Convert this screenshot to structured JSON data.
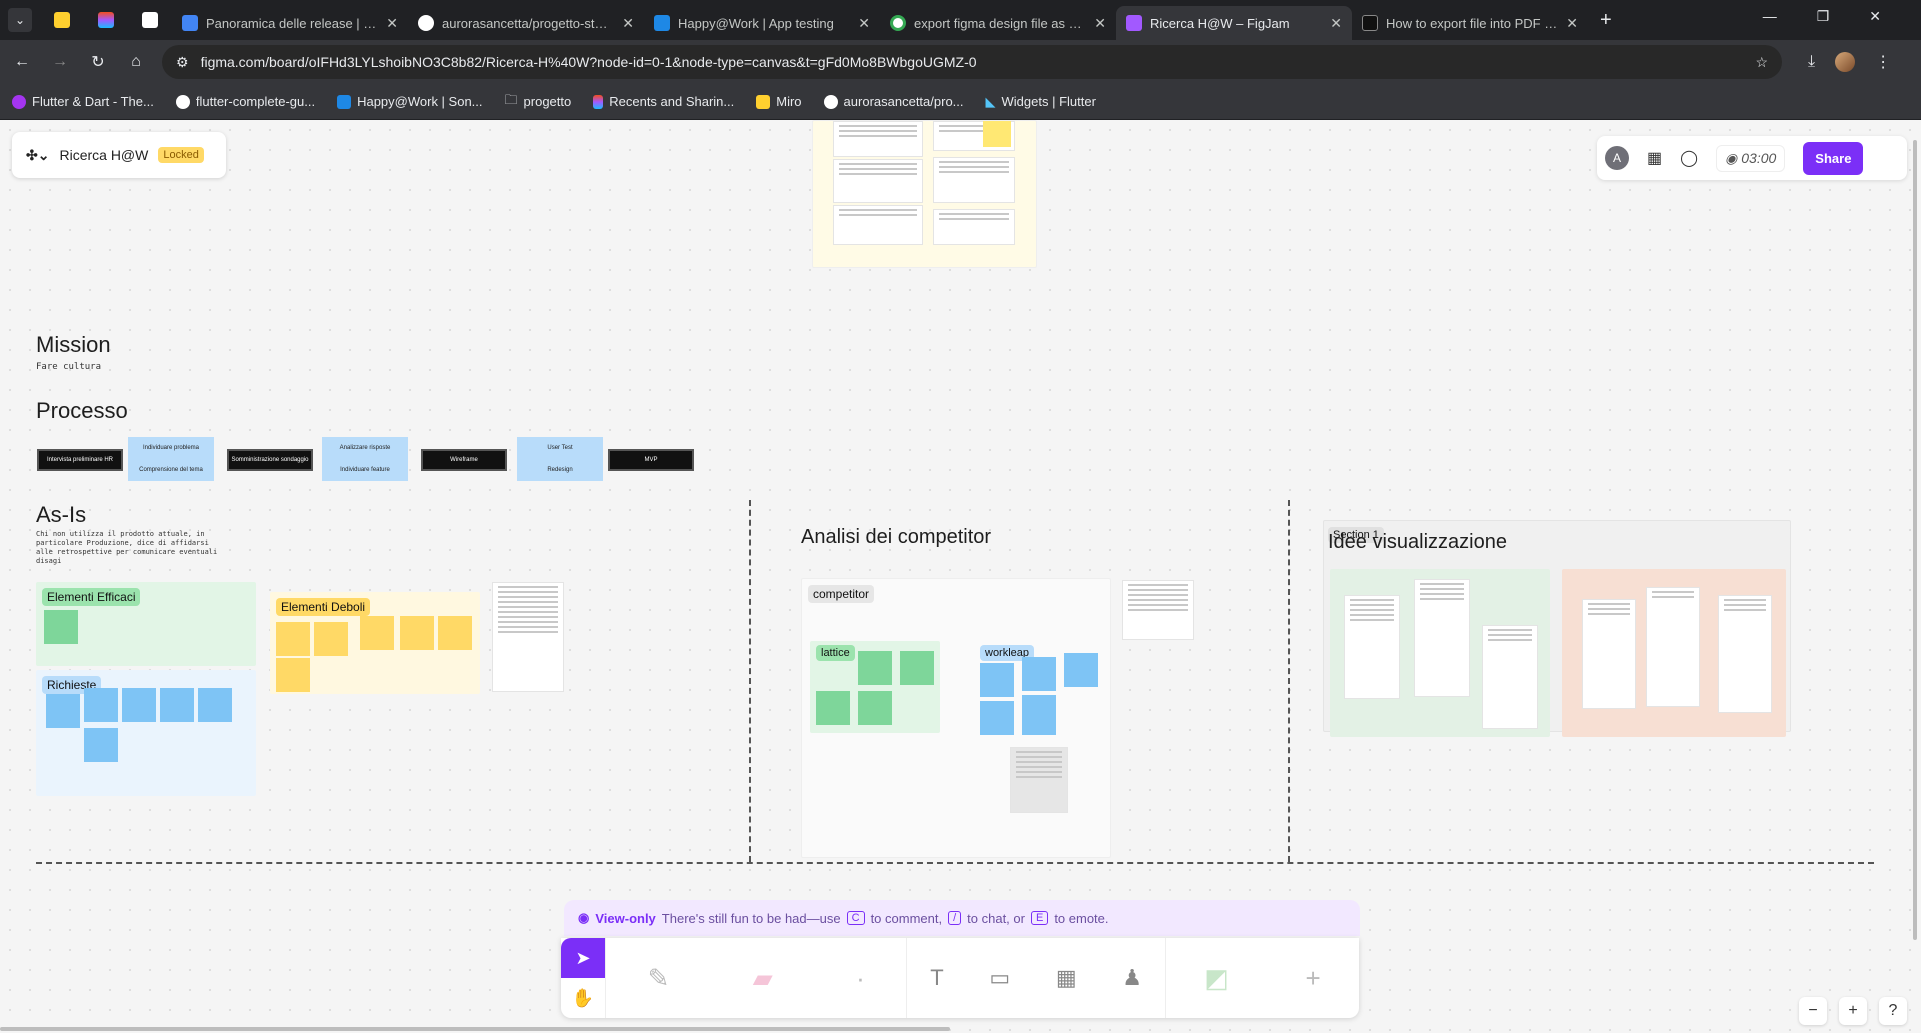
{
  "browser": {
    "tabs": [
      {
        "title": "Panoramica delle release | Happ",
        "color": "#4285f4"
      },
      {
        "title": "aurorasancetta/progetto-stage",
        "color": "#ffffff"
      },
      {
        "title": "Happy@Work | App testing",
        "color": "#1e88e5"
      },
      {
        "title": "export figma design file as pdf",
        "color": "#34a853"
      },
      {
        "title": "Ricerca H@W – FigJam",
        "color": "#a259ff"
      },
      {
        "title": "How to export file into PDF in F",
        "color": "#111111"
      }
    ],
    "url": "figma.com/board/oIFHd3LYLshoibNO3C8b82/Ricerca-H%40W?node-id=0-1&node-type=canvas&t=gFd0Mo8BWbgoUGMZ-0",
    "bookmarks": [
      "Flutter & Dart - The...",
      "flutter-complete-gu...",
      "Happy@Work | Son...",
      "progetto",
      "Recents and Sharin...",
      "Miro",
      "aurorasancetta/pro...",
      "Widgets | Flutter"
    ]
  },
  "figjam": {
    "file_name": "Ricerca H@W",
    "locked_label": "Locked",
    "avatar_initial": "A",
    "timer": "03:00",
    "share_label": "Share",
    "accent": "#7b2ff7"
  },
  "canvas": {
    "mission_title": "Mission",
    "mission_sub": "Fare cultura",
    "processo_title": "Processo",
    "process_steps": [
      {
        "type": "dark",
        "label": "Intervista preliminare HR"
      },
      {
        "type": "light",
        "top": "Individuare problema",
        "bottom": "Comprensione del tema"
      },
      {
        "type": "dark",
        "label": "Somministrazione sondaggio"
      },
      {
        "type": "light",
        "top": "Analizzare risposte",
        "bottom": "Individuare feature"
      },
      {
        "type": "dark",
        "label": "Wireframe"
      },
      {
        "type": "light",
        "top": "User Test",
        "bottom": "Redesign"
      },
      {
        "type": "dark",
        "label": "MVP"
      }
    ],
    "asis_title": "As-Is",
    "asis_sub": "Chi non utilizza il prodotto attuale, in particolare Produzione, dice di affidarsi alle retrospettive per comunicare eventuali disagi",
    "elementi_efficaci": "Elementi Efficaci",
    "elementi_deboli": "Elementi Deboli",
    "richieste": "Richieste",
    "analisi_title": "Analisi dei competitor",
    "competitor_label": "competitor",
    "lattice_label": "lattice",
    "workleap_label": "workleap",
    "idee_title": "Idee visualizzazione",
    "section_label": "Section 1"
  },
  "bottom_bar": {
    "view_only": "View-only",
    "hint_1": "There's still fun to be had—use",
    "key_c": "C",
    "hint_2": "to comment,",
    "key_slash": "/",
    "hint_3": "to chat, or",
    "key_e": "E",
    "hint_4": "to emote."
  },
  "zoom": {
    "minus": "−",
    "plus": "+",
    "help": "?"
  }
}
